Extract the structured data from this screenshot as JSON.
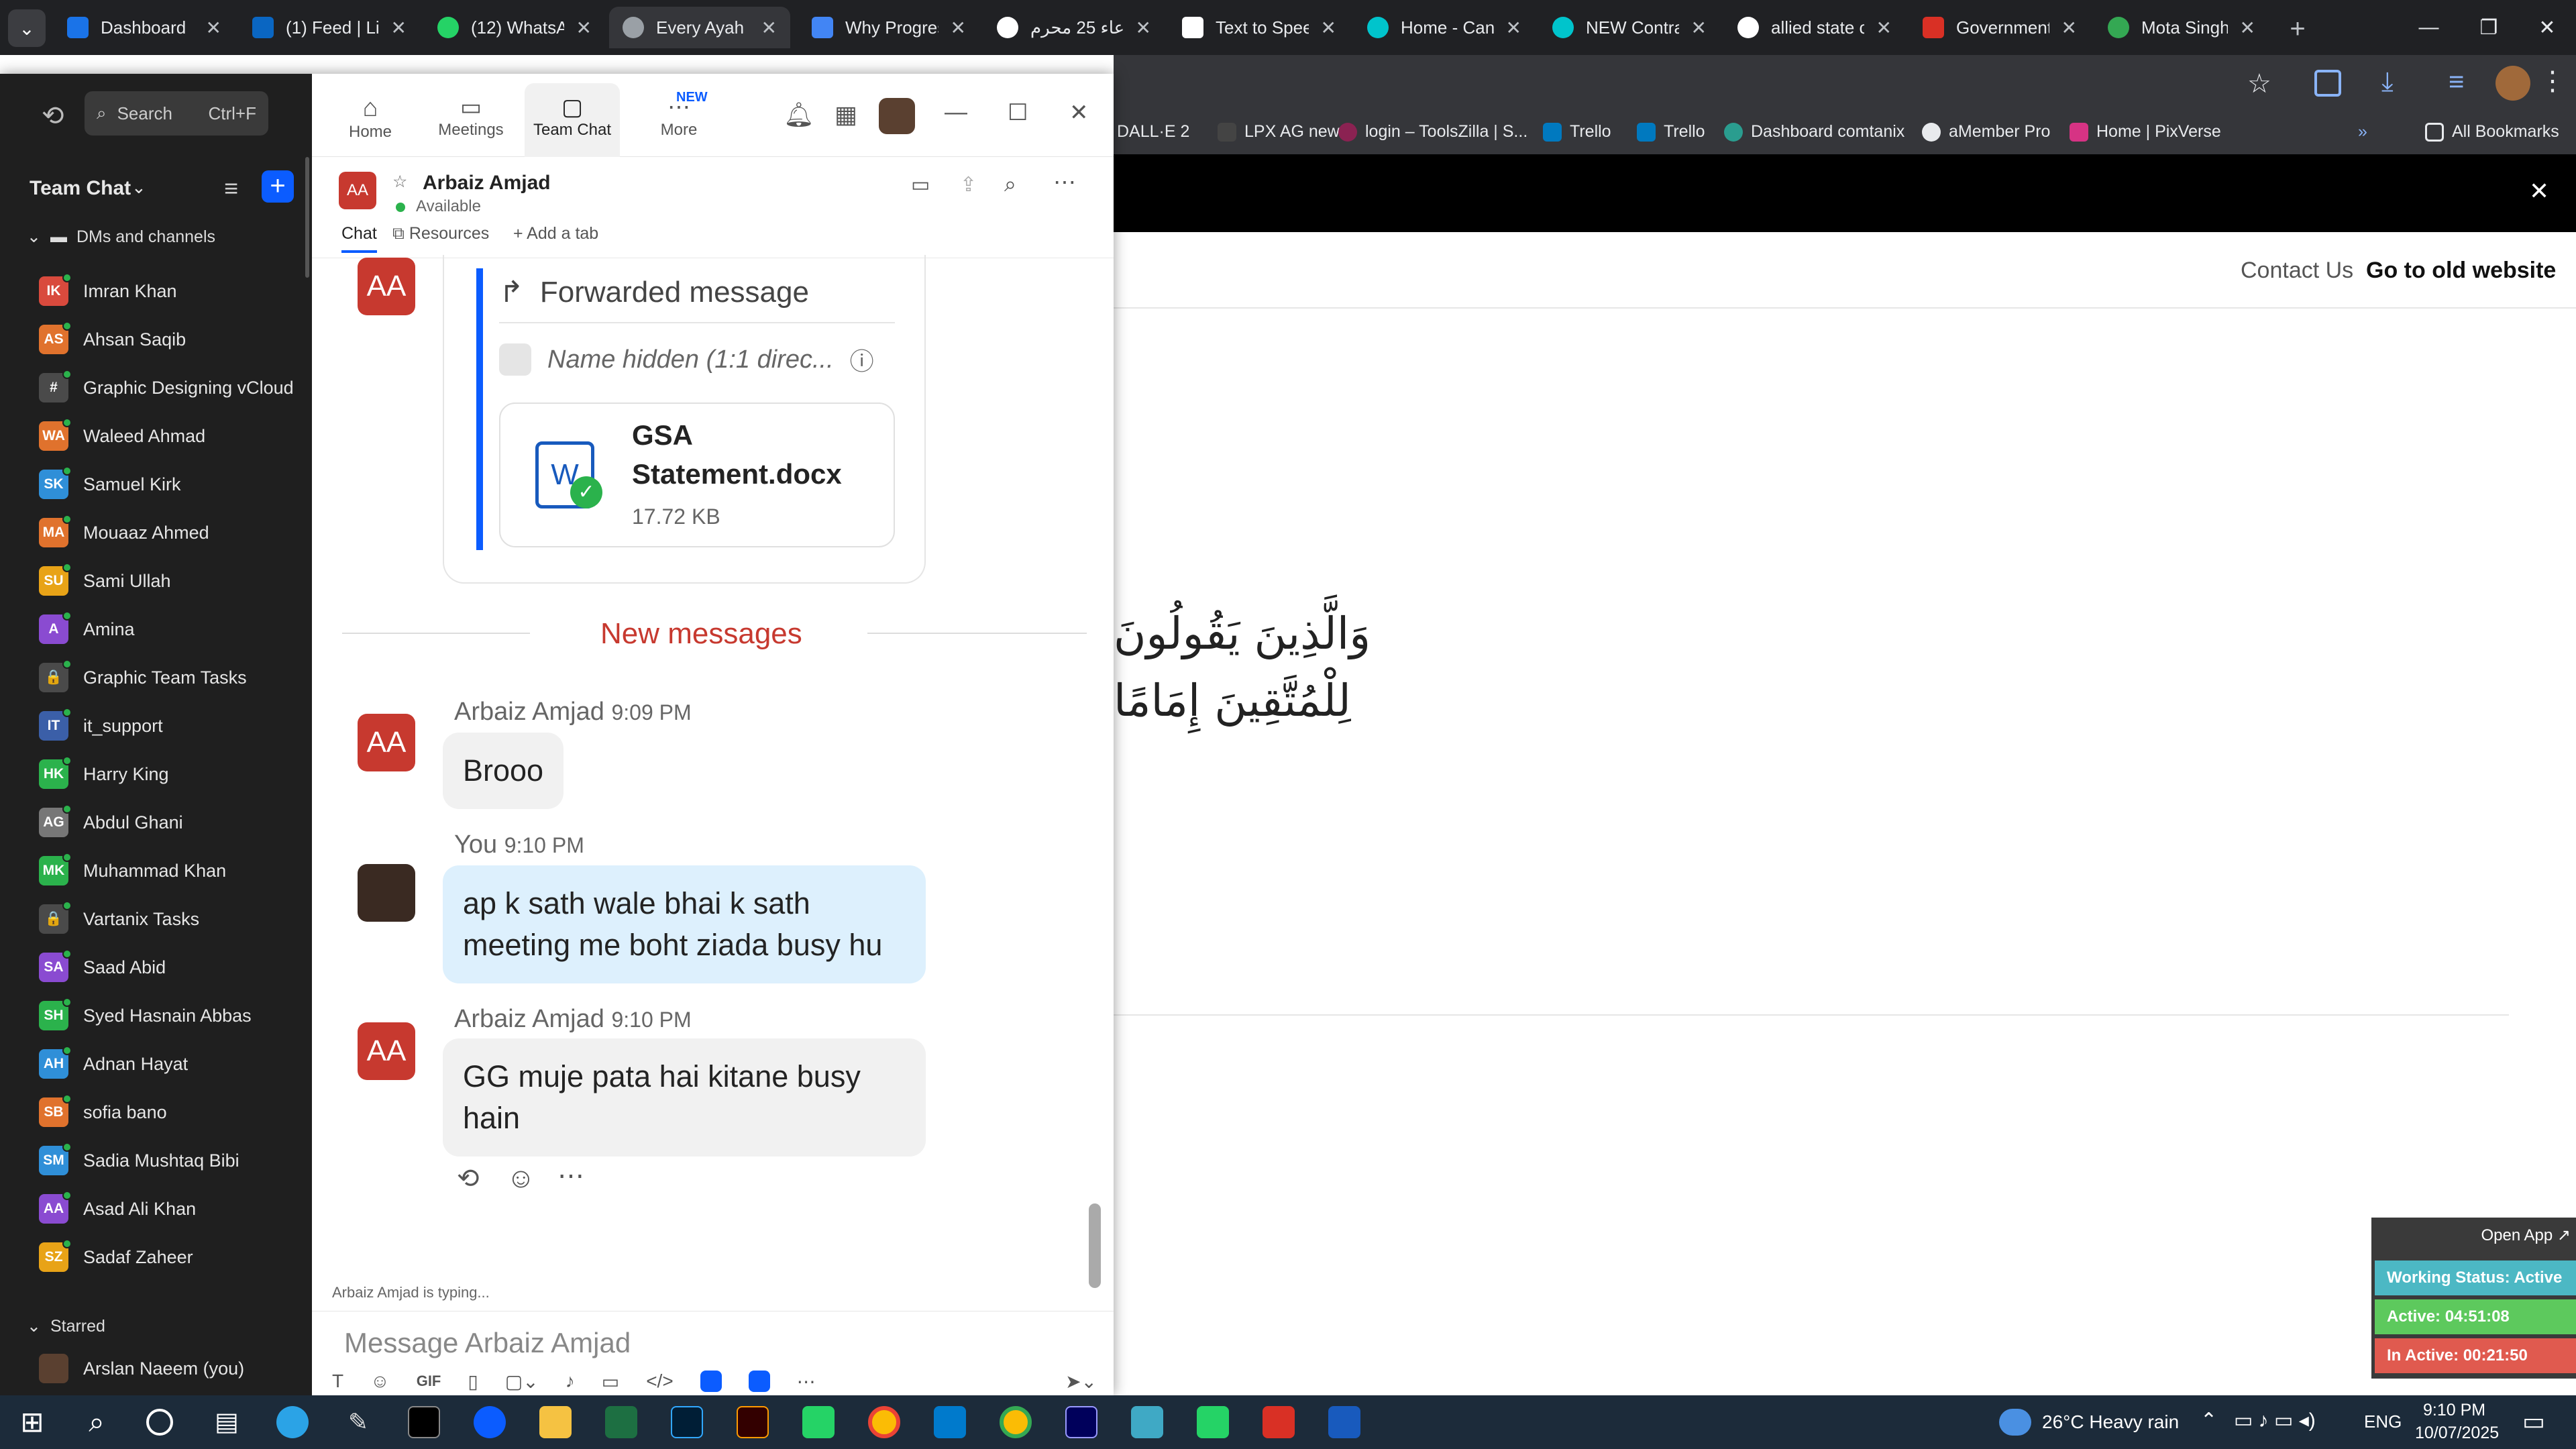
{
  "browser": {
    "tabs": [
      "Dashboard",
      "(1) Feed | Lin",
      "(12) WhatsAp",
      "Every Ayah",
      "Why Progres",
      "دعاء 25 محرم",
      "Text to Spee",
      "Home - Can",
      "NEW Contra",
      "allied state c",
      "Government",
      "Mota Singh"
    ],
    "bookmarks": [
      "DALL·E 2",
      "LPX AG new",
      "login – ToolsZilla | S...",
      "Trello",
      "Trello",
      "Dashboard comtanix",
      "aMember Pro",
      "Home | PixVerse",
      "All Bookmarks"
    ]
  },
  "webpage": {
    "contact": "Contact Us",
    "old_site": "Go to old website",
    "arabic1": "وَالَّذِينَ يَقُولُونَ",
    "arabic2": "لِلْمُتَّقِينَ إِمَامًا"
  },
  "zoom": {
    "search_label": "Search",
    "search_shortcut": "Ctrl+F",
    "nav": [
      "Home",
      "Meetings",
      "Team Chat",
      "More"
    ],
    "new_badge": "NEW",
    "section_title": "Team Chat",
    "dm_header": "DMs and channels",
    "starred_header": "Starred",
    "contacts": [
      {
        "initials": "IK",
        "name": "Imran Khan",
        "color": "#d94a3d"
      },
      {
        "initials": "AS",
        "name": "Ahsan Saqib",
        "color": "#e0722d"
      },
      {
        "initials": "#",
        "name": "Graphic Designing vCloud",
        "color": "#4a4a4a"
      },
      {
        "initials": "WA",
        "name": "Waleed Ahmad",
        "color": "#e0722d"
      },
      {
        "initials": "SK",
        "name": "Samuel Kirk",
        "color": "#2f8fd8"
      },
      {
        "initials": "MA",
        "name": "Mouaaz Ahmed",
        "color": "#e0722d"
      },
      {
        "initials": "SU",
        "name": "Sami Ullah",
        "color": "#e8a317"
      },
      {
        "initials": "A",
        "name": "Amina",
        "color": "#8a4bd1"
      },
      {
        "initials": "🔒",
        "name": "Graphic Team Tasks",
        "color": "#4a4a4a"
      },
      {
        "initials": "IT",
        "name": "it_support",
        "color": "#3b5fa8"
      },
      {
        "initials": "HK",
        "name": "Harry King",
        "color": "#2bb24c"
      },
      {
        "initials": "AG",
        "name": "Abdul Ghani",
        "color": "#777777"
      },
      {
        "initials": "MK",
        "name": "Muhammad Khan",
        "color": "#2bb24c"
      },
      {
        "initials": "🔒",
        "name": "Vartanix Tasks",
        "color": "#4a4a4a"
      },
      {
        "initials": "SA",
        "name": "Saad Abid",
        "color": "#8a4bd1"
      },
      {
        "initials": "SH",
        "name": "Syed Hasnain Abbas",
        "color": "#2bb24c"
      },
      {
        "initials": "AH",
        "name": "Adnan Hayat",
        "color": "#2f8fd8"
      },
      {
        "initials": "SB",
        "name": "sofia bano",
        "color": "#e0722d"
      },
      {
        "initials": "SM",
        "name": "Sadia Mushtaq Bibi",
        "color": "#2f8fd8"
      },
      {
        "initials": "AA",
        "name": "Asad Ali Khan",
        "color": "#8a4bd1"
      },
      {
        "initials": "SZ",
        "name": "Sadaf Zaheer",
        "color": "#e8a317"
      }
    ],
    "starred_user": "Arslan Naeem (you)",
    "chat": {
      "name": "Arbaiz Amjad",
      "initials": "AA",
      "status": "Available",
      "tabs": [
        "Chat",
        "Resources",
        "Add a tab"
      ],
      "forwarded": "Forwarded message",
      "hidden": "Name hidden (1:1 direc...",
      "file_name": "GSA Statement.docx",
      "file_size": "17.72 KB",
      "new_messages": "New messages",
      "messages": [
        {
          "sender": "Arbaiz Amjad",
          "time": "9:09 PM",
          "text": "Brooo"
        },
        {
          "sender": "You",
          "time": "9:10 PM",
          "text": "ap k sath wale bhai k sath meeting me boht ziada busy hu"
        },
        {
          "sender": "Arbaiz Amjad",
          "time": "9:10 PM",
          "text": "GG muje pata hai kitane busy hain"
        }
      ],
      "typing": "Arbaiz Amjad  is typing...",
      "placeholder": "Message Arbaiz Amjad",
      "gif": "GIF"
    }
  },
  "widget": {
    "open_app": "Open App ↗",
    "working": "Working Status: Active",
    "active": "Active: 04:51:08",
    "inactive": "In Active: 00:21:50"
  },
  "taskbar": {
    "weather": "26°C  Heavy rain",
    "lang": "ENG",
    "time": "9:10 PM",
    "date": "10/07/2025"
  }
}
